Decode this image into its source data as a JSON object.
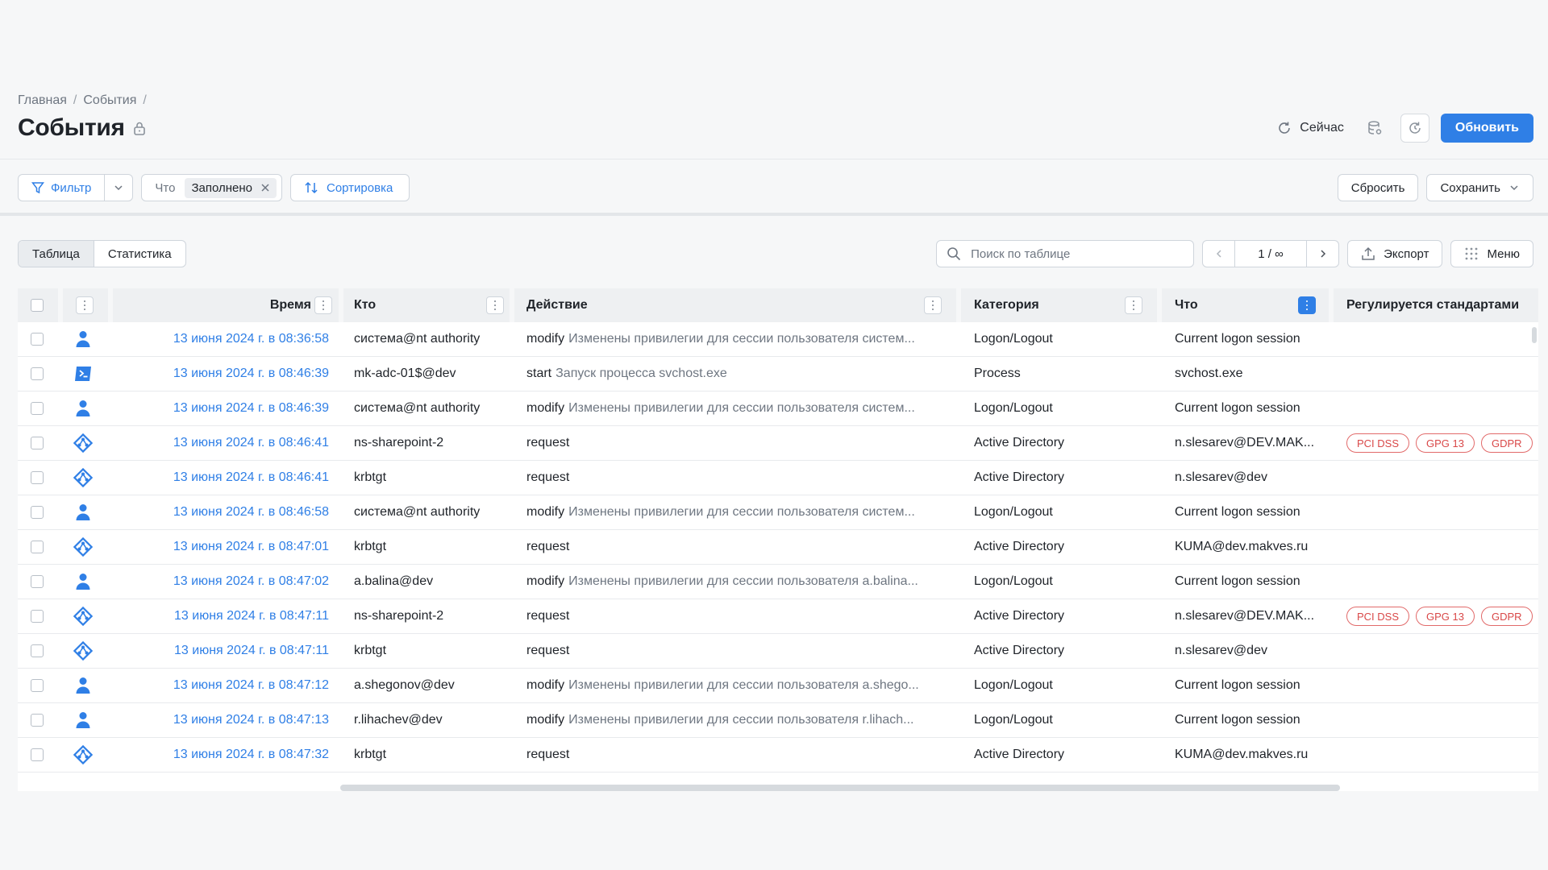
{
  "breadcrumb": {
    "home": "Главная",
    "events": "События",
    "sep": "/"
  },
  "title": "События",
  "header": {
    "now_label": "Сейчас",
    "refresh_label": "Обновить"
  },
  "filterbar": {
    "filter_label": "Фильтр",
    "chip_key": "Что",
    "chip_value": "Заполнено",
    "sort_label": "Сортировка",
    "reset_label": "Сбросить",
    "save_label": "Сохранить"
  },
  "toolbar": {
    "tab_table": "Таблица",
    "tab_stats": "Статистика",
    "search_placeholder": "Поиск по таблице",
    "page": "1 / ∞",
    "export_label": "Экспорт",
    "menu_label": "Меню"
  },
  "columns": {
    "time": "Время",
    "who": "Кто",
    "action": "Действие",
    "category": "Категория",
    "what": "Что",
    "standards": "Регулируется стандартами"
  },
  "colors": {
    "accent": "#2f7fe6",
    "badge": "#d94848"
  },
  "rows": [
    {
      "icon": "user-icon",
      "time": "13 июня 2024 г. в 08:36:58",
      "who": "система@nt authority",
      "verb": "modify",
      "desc": "Изменены привилегии для сессии пользователя систем...",
      "category": "Logon/Logout",
      "what": "Current logon session",
      "badges": []
    },
    {
      "icon": "process-icon",
      "time": "13 июня 2024 г. в 08:46:39",
      "who": "mk-adc-01$@dev",
      "verb": "start",
      "desc": "Запуск процесса svchost.exe",
      "category": "Process",
      "what": "svchost.exe",
      "badges": []
    },
    {
      "icon": "user-icon",
      "time": "13 июня 2024 г. в 08:46:39",
      "who": "система@nt authority",
      "verb": "modify",
      "desc": "Изменены привилегии для сессии пользователя систем...",
      "category": "Logon/Logout",
      "what": "Current logon session",
      "badges": []
    },
    {
      "icon": "directory-icon",
      "time": "13 июня 2024 г. в 08:46:41",
      "who": "ns-sharepoint-2",
      "verb": "request",
      "desc": "",
      "category": "Active Directory",
      "what": "n.slesarev@DEV.MAK...",
      "badges": [
        "PCI DSS",
        "GPG 13",
        "GDPR"
      ]
    },
    {
      "icon": "directory-icon",
      "time": "13 июня 2024 г. в 08:46:41",
      "who": "krbtgt",
      "verb": "request",
      "desc": "",
      "category": "Active Directory",
      "what": "n.slesarev@dev",
      "badges": []
    },
    {
      "icon": "user-icon",
      "time": "13 июня 2024 г. в 08:46:58",
      "who": "система@nt authority",
      "verb": "modify",
      "desc": "Изменены привилегии для сессии пользователя систем...",
      "category": "Logon/Logout",
      "what": "Current logon session",
      "badges": []
    },
    {
      "icon": "directory-icon",
      "time": "13 июня 2024 г. в 08:47:01",
      "who": "krbtgt",
      "verb": "request",
      "desc": "",
      "category": "Active Directory",
      "what": "KUMA@dev.makves.ru",
      "badges": []
    },
    {
      "icon": "user-icon",
      "time": "13 июня 2024 г. в 08:47:02",
      "who": "a.balina@dev",
      "verb": "modify",
      "desc": "Изменены привилегии для сессии пользователя a.balina...",
      "category": "Logon/Logout",
      "what": "Current logon session",
      "badges": []
    },
    {
      "icon": "directory-icon",
      "time": "13 июня 2024 г. в 08:47:11",
      "who": "ns-sharepoint-2",
      "verb": "request",
      "desc": "",
      "category": "Active Directory",
      "what": "n.slesarev@DEV.MAK...",
      "badges": [
        "PCI DSS",
        "GPG 13",
        "GDPR"
      ]
    },
    {
      "icon": "directory-icon",
      "time": "13 июня 2024 г. в 08:47:11",
      "who": "krbtgt",
      "verb": "request",
      "desc": "",
      "category": "Active Directory",
      "what": "n.slesarev@dev",
      "badges": []
    },
    {
      "icon": "user-icon",
      "time": "13 июня 2024 г. в 08:47:12",
      "who": "a.shegonov@dev",
      "verb": "modify",
      "desc": "Изменены привилегии для сессии пользователя a.shego...",
      "category": "Logon/Logout",
      "what": "Current logon session",
      "badges": []
    },
    {
      "icon": "user-icon",
      "time": "13 июня 2024 г. в 08:47:13",
      "who": "r.lihachev@dev",
      "verb": "modify",
      "desc": "Изменены привилегии для сессии пользователя r.lihach...",
      "category": "Logon/Logout",
      "what": "Current logon session",
      "badges": []
    },
    {
      "icon": "directory-icon",
      "time": "13 июня 2024 г. в 08:47:32",
      "who": "krbtgt",
      "verb": "request",
      "desc": "",
      "category": "Active Directory",
      "what": "KUMA@dev.makves.ru",
      "badges": []
    }
  ]
}
